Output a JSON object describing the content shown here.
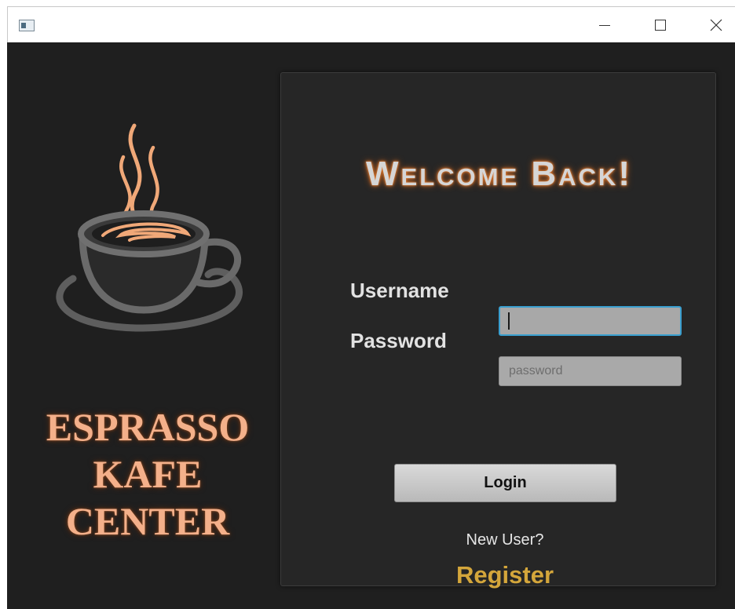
{
  "window": {
    "icon": "app-window-icon",
    "controls": {
      "minimize": "minimize-icon",
      "maximize": "maximize-icon",
      "close": "close-icon"
    }
  },
  "branding": {
    "logo": "coffee-cup-icon",
    "lines": [
      "ESPRASSO",
      "KAFE",
      "CENTER"
    ],
    "color": "#f4b08a"
  },
  "panel": {
    "welcome": "Welcome Back!",
    "username_label": "Username",
    "username_value": "",
    "password_label": "Password",
    "password_placeholder": "password",
    "login_label": "Login",
    "new_user_text": "New User?",
    "register_label": "Register",
    "register_color": "#d4a63b"
  }
}
